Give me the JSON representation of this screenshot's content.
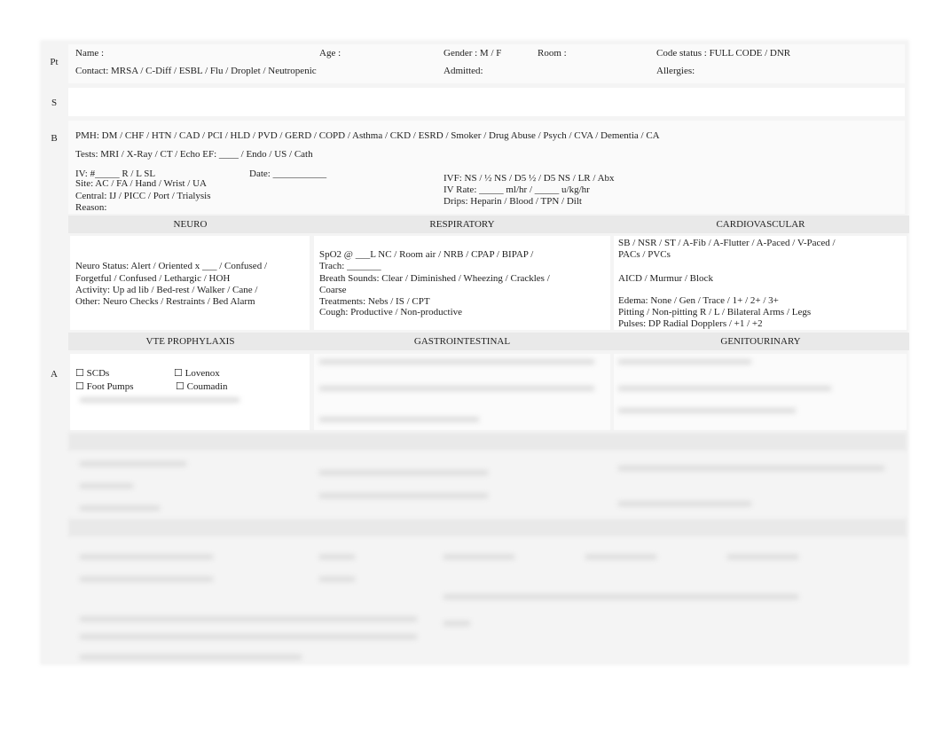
{
  "rows": {
    "pt": "Pt",
    "s": "S",
    "b": "B",
    "a": "A"
  },
  "pt": {
    "name": "Name :",
    "age": "Age :",
    "gender": "Gender  : M / F",
    "room": "Room :",
    "code_status": "Code status     : FULL CODE / DNR",
    "contact": "Contact:    MRSA / C-Diff / ESBL / Flu / Droplet / Neutropenic",
    "admitted": "Admitted:",
    "allergies": "Allergies:"
  },
  "b": {
    "pmh": "PMH:  DM  /  CHF  /  HTN  /  CAD  /  PCI  /  HLD  /  PVD  /  GERD  /  COPD   /  Asthma  /  CKD  /  ESRD  /  Smoker   / Drug Abuse    /  Psych   /  CVA  /  Dementia /     CA",
    "tests": "Tests:     MRI    /     X-Ray     /     CT     /     Echo EF:   ____   /     Endo     /     US     /     Cath",
    "iv": "IV:  #_____   R  /  L     SL",
    "date": "Date:   ___________",
    "site": "Site:   AC  /  FA  /   Hand   /   Wrist  /   UA",
    "central": "Central:    IJ   /  PICC  /   Port   /  Trialysis",
    "reason": "Reason:",
    "ivf": "IVF:  NS  /  ½ NS   /   D5 ½  /  D5 NS   /   LR  /   Abx",
    "iv_rate": "IV Rate:   _____ ml/hr     /      _____ u/kg/hr",
    "drips": "Drips:    Heparin    /   Blood   /   TPN   /   Dilt"
  },
  "sections": {
    "neuro": "NEURO",
    "resp": "RESPIRATORY",
    "cardio": "CARDIOVASCULAR",
    "vte": "VTE PROPHYLAXIS",
    "gi": "GASTROINTESTINAL",
    "gu": "GENITOURINARY"
  },
  "neuro": [
    "Neuro Status:     Alert / Oriented x     ___ /   Confused /",
    "Forgetful / Confused / Lethargic / HOH",
    "Activity:   Up ad lib / Bed-rest / Walker        /   Cane /",
    "Other:   Neuro Checks /      Restraints    /   Bed Alarm"
  ],
  "resp": [
    "SpO2   @ ___L  NC   /   Room air    /  NRB  /   CPAP    /   BIPAP   /",
    "Trach:    _______",
    "Breath Sounds:        Clear   /   Diminished    /   Wheezing   /  Crackles    /",
    "Coarse",
    "Treatments:       Nebs    /   IS   /   CPT",
    "Cough:     Productive     /   Non-productive"
  ],
  "cardio": [
    "SB   /   NSR   /  ST   /   A-Fib   /  A-Flutter   /   A-Paced     /   V-Paced     /",
    "PACs   /   PVCs",
    "AICD  /   Murmur   /   Block",
    "Edema:    None    /  Gen    /   Trace    /  1+   /   2+   /   3+",
    "Pitting /     Non-pitting              R   /   L   /   Bilateral          Arms   /   Legs",
    "Pulses:    DP  Radial          Dopplers    /   +1   /  +2"
  ],
  "vte": {
    "scds": "☐ SCDs",
    "lovenox": "☐ Lovenox",
    "foot_pumps": "☐ Foot Pumps",
    "coumadin": "☐ Coumadin"
  }
}
